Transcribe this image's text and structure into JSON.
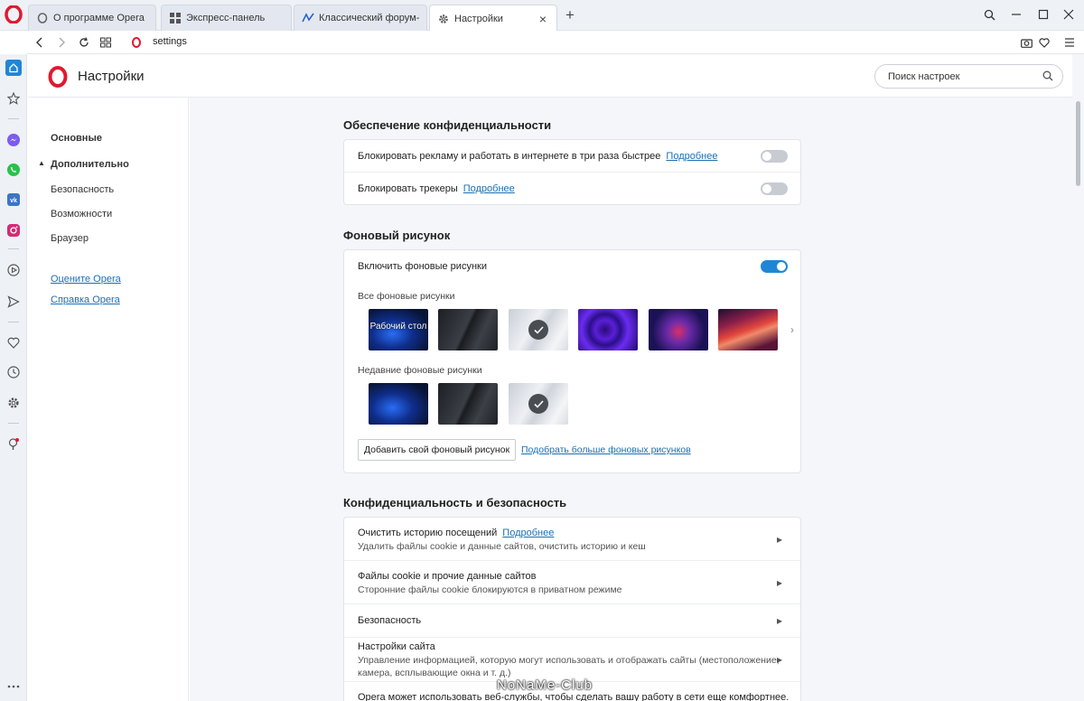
{
  "tabs": [
    {
      "label": "О программе Opera",
      "icon": "opera-icon"
    },
    {
      "label": "Экспресс-панель",
      "icon": "grid-icon"
    },
    {
      "label": "Классический форум-тре",
      "icon": "forum-icon"
    },
    {
      "label": "Настройки",
      "icon": "gear-icon"
    }
  ],
  "address": {
    "url": "settings"
  },
  "header": {
    "title": "Настройки",
    "search_placeholder": "Поиск настроек"
  },
  "nav": {
    "basic": "Основные",
    "advanced": "Дополнительно",
    "security": "Безопасность",
    "features": "Возможности",
    "browser": "Браузер",
    "rate": "Оцените Opera",
    "help": "Справка Opera"
  },
  "privacy": {
    "title": "Обеспечение конфиденциальности",
    "block_ads": "Блокировать рекламу и работать в интернете в три раза быстрее",
    "block_ads_on": false,
    "block_trackers": "Блокировать трекеры",
    "block_trackers_on": false,
    "more": "Подробнее"
  },
  "wallpaper": {
    "title": "Фоновый рисунок",
    "enable": "Включить фоновые рисунки",
    "enable_on": true,
    "all": "Все фоновые рисунки",
    "desktop_label": "Рабочий стол",
    "recent": "Недавние фоновые рисунки",
    "add_button": "Добавить свой фоновый рисунок",
    "more_link": "Подобрать больше фоновых рисунков"
  },
  "security": {
    "title": "Конфиденциальность и безопасность",
    "rows": [
      {
        "title": "Очистить историю посещений",
        "link": "Подробнее",
        "sub": "Удалить файлы cookie и данные сайтов, очистить историю и кеш"
      },
      {
        "title": "Файлы cookie и прочие данные сайтов",
        "sub": "Сторонние файлы cookie блокируются в приватном режиме"
      },
      {
        "title": "Безопасность"
      },
      {
        "title": "Настройки сайта",
        "sub": "Управление информацией, которую могут использовать и отображать сайты (местоположение,",
        "sub2": "камера, всплывающие окна и т. д.)"
      },
      {
        "title": "Opera может использовать веб-службы, чтобы сделать вашу работу в сети еще комфортнее. При"
      }
    ]
  },
  "watermark": "NoNaMe-Club"
}
